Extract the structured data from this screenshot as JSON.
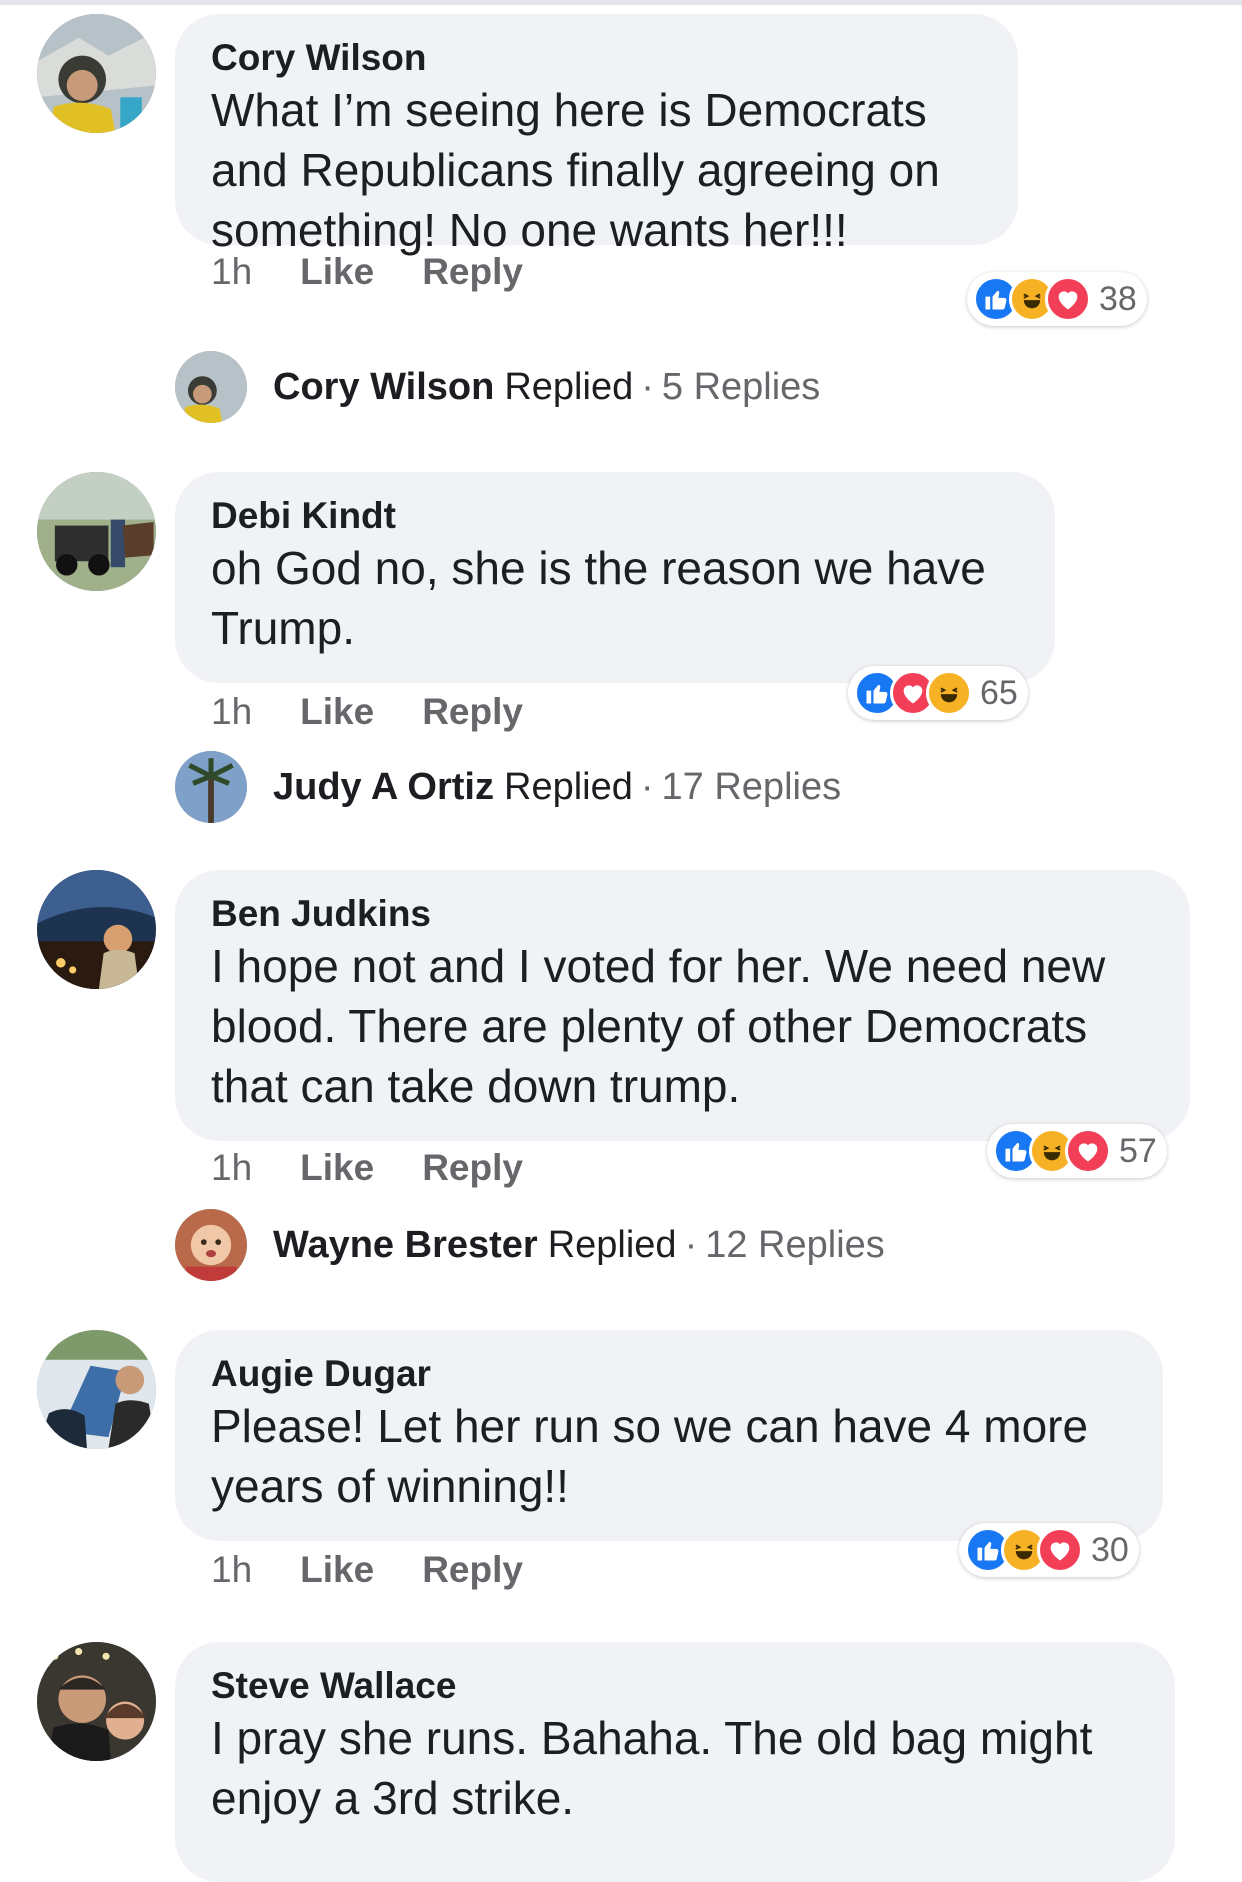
{
  "comments": [
    {
      "author": "Cory Wilson",
      "text": "What I’m seeing here is Democrats and Republicans finally agreeing on something! No one wants her!!!",
      "time": "1h",
      "like_label": "Like",
      "reply_label": "Reply",
      "reactions": [
        "like",
        "haha",
        "love"
      ],
      "reaction_count": "38",
      "replied": {
        "name": "Cory Wilson",
        "verb": "Replied",
        "sep": "·",
        "count": "5 Replies"
      }
    },
    {
      "author": "Debi Kindt",
      "text": "oh God no, she is the reason we have Trump.",
      "time": "1h",
      "like_label": "Like",
      "reply_label": "Reply",
      "reactions": [
        "like",
        "love",
        "haha"
      ],
      "reaction_count": "65",
      "replied": {
        "name": "Judy A Ortiz",
        "verb": "Replied",
        "sep": "·",
        "count": "17 Replies"
      }
    },
    {
      "author": "Ben Judkins",
      "text": "I hope not and I voted for her. We need new blood. There are plenty of other Democrats that can take down trump.",
      "time": "1h",
      "like_label": "Like",
      "reply_label": "Reply",
      "reactions": [
        "like",
        "haha",
        "love"
      ],
      "reaction_count": "57",
      "replied": {
        "name": "Wayne Brester",
        "verb": "Replied",
        "sep": "·",
        "count": "12 Replies"
      }
    },
    {
      "author": "Augie Dugar",
      "text": "Please! Let her run so we can have 4 more years of winning!!",
      "time": "1h",
      "like_label": "Like",
      "reply_label": "Reply",
      "reactions": [
        "like",
        "haha",
        "love"
      ],
      "reaction_count": "30"
    },
    {
      "author": "Steve Wallace",
      "text": "I pray she runs. Bahaha. The old bag might enjoy a 3rd strike."
    }
  ],
  "colors": {
    "bubble": "#f0f2f5",
    "like": "#1877f2",
    "love": "#f33e58",
    "haha": "#f7b125",
    "meta": "#65676b"
  }
}
